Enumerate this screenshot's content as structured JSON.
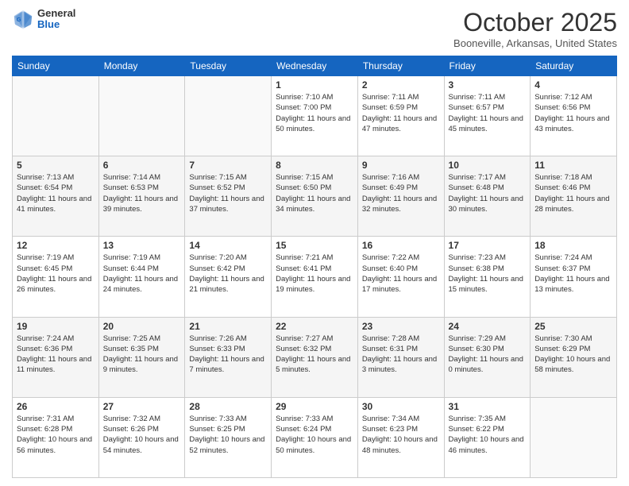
{
  "header": {
    "logo": {
      "general": "General",
      "blue": "Blue"
    },
    "title": "October 2025",
    "location": "Booneville, Arkansas, United States"
  },
  "weekdays": [
    "Sunday",
    "Monday",
    "Tuesday",
    "Wednesday",
    "Thursday",
    "Friday",
    "Saturday"
  ],
  "weeks": [
    [
      {
        "day": "",
        "sunrise": "",
        "sunset": "",
        "daylight": ""
      },
      {
        "day": "",
        "sunrise": "",
        "sunset": "",
        "daylight": ""
      },
      {
        "day": "",
        "sunrise": "",
        "sunset": "",
        "daylight": ""
      },
      {
        "day": "1",
        "sunrise": "Sunrise: 7:10 AM",
        "sunset": "Sunset: 7:00 PM",
        "daylight": "Daylight: 11 hours and 50 minutes."
      },
      {
        "day": "2",
        "sunrise": "Sunrise: 7:11 AM",
        "sunset": "Sunset: 6:59 PM",
        "daylight": "Daylight: 11 hours and 47 minutes."
      },
      {
        "day": "3",
        "sunrise": "Sunrise: 7:11 AM",
        "sunset": "Sunset: 6:57 PM",
        "daylight": "Daylight: 11 hours and 45 minutes."
      },
      {
        "day": "4",
        "sunrise": "Sunrise: 7:12 AM",
        "sunset": "Sunset: 6:56 PM",
        "daylight": "Daylight: 11 hours and 43 minutes."
      }
    ],
    [
      {
        "day": "5",
        "sunrise": "Sunrise: 7:13 AM",
        "sunset": "Sunset: 6:54 PM",
        "daylight": "Daylight: 11 hours and 41 minutes."
      },
      {
        "day": "6",
        "sunrise": "Sunrise: 7:14 AM",
        "sunset": "Sunset: 6:53 PM",
        "daylight": "Daylight: 11 hours and 39 minutes."
      },
      {
        "day": "7",
        "sunrise": "Sunrise: 7:15 AM",
        "sunset": "Sunset: 6:52 PM",
        "daylight": "Daylight: 11 hours and 37 minutes."
      },
      {
        "day": "8",
        "sunrise": "Sunrise: 7:15 AM",
        "sunset": "Sunset: 6:50 PM",
        "daylight": "Daylight: 11 hours and 34 minutes."
      },
      {
        "day": "9",
        "sunrise": "Sunrise: 7:16 AM",
        "sunset": "Sunset: 6:49 PM",
        "daylight": "Daylight: 11 hours and 32 minutes."
      },
      {
        "day": "10",
        "sunrise": "Sunrise: 7:17 AM",
        "sunset": "Sunset: 6:48 PM",
        "daylight": "Daylight: 11 hours and 30 minutes."
      },
      {
        "day": "11",
        "sunrise": "Sunrise: 7:18 AM",
        "sunset": "Sunset: 6:46 PM",
        "daylight": "Daylight: 11 hours and 28 minutes."
      }
    ],
    [
      {
        "day": "12",
        "sunrise": "Sunrise: 7:19 AM",
        "sunset": "Sunset: 6:45 PM",
        "daylight": "Daylight: 11 hours and 26 minutes."
      },
      {
        "day": "13",
        "sunrise": "Sunrise: 7:19 AM",
        "sunset": "Sunset: 6:44 PM",
        "daylight": "Daylight: 11 hours and 24 minutes."
      },
      {
        "day": "14",
        "sunrise": "Sunrise: 7:20 AM",
        "sunset": "Sunset: 6:42 PM",
        "daylight": "Daylight: 11 hours and 21 minutes."
      },
      {
        "day": "15",
        "sunrise": "Sunrise: 7:21 AM",
        "sunset": "Sunset: 6:41 PM",
        "daylight": "Daylight: 11 hours and 19 minutes."
      },
      {
        "day": "16",
        "sunrise": "Sunrise: 7:22 AM",
        "sunset": "Sunset: 6:40 PM",
        "daylight": "Daylight: 11 hours and 17 minutes."
      },
      {
        "day": "17",
        "sunrise": "Sunrise: 7:23 AM",
        "sunset": "Sunset: 6:38 PM",
        "daylight": "Daylight: 11 hours and 15 minutes."
      },
      {
        "day": "18",
        "sunrise": "Sunrise: 7:24 AM",
        "sunset": "Sunset: 6:37 PM",
        "daylight": "Daylight: 11 hours and 13 minutes."
      }
    ],
    [
      {
        "day": "19",
        "sunrise": "Sunrise: 7:24 AM",
        "sunset": "Sunset: 6:36 PM",
        "daylight": "Daylight: 11 hours and 11 minutes."
      },
      {
        "day": "20",
        "sunrise": "Sunrise: 7:25 AM",
        "sunset": "Sunset: 6:35 PM",
        "daylight": "Daylight: 11 hours and 9 minutes."
      },
      {
        "day": "21",
        "sunrise": "Sunrise: 7:26 AM",
        "sunset": "Sunset: 6:33 PM",
        "daylight": "Daylight: 11 hours and 7 minutes."
      },
      {
        "day": "22",
        "sunrise": "Sunrise: 7:27 AM",
        "sunset": "Sunset: 6:32 PM",
        "daylight": "Daylight: 11 hours and 5 minutes."
      },
      {
        "day": "23",
        "sunrise": "Sunrise: 7:28 AM",
        "sunset": "Sunset: 6:31 PM",
        "daylight": "Daylight: 11 hours and 3 minutes."
      },
      {
        "day": "24",
        "sunrise": "Sunrise: 7:29 AM",
        "sunset": "Sunset: 6:30 PM",
        "daylight": "Daylight: 11 hours and 0 minutes."
      },
      {
        "day": "25",
        "sunrise": "Sunrise: 7:30 AM",
        "sunset": "Sunset: 6:29 PM",
        "daylight": "Daylight: 10 hours and 58 minutes."
      }
    ],
    [
      {
        "day": "26",
        "sunrise": "Sunrise: 7:31 AM",
        "sunset": "Sunset: 6:28 PM",
        "daylight": "Daylight: 10 hours and 56 minutes."
      },
      {
        "day": "27",
        "sunrise": "Sunrise: 7:32 AM",
        "sunset": "Sunset: 6:26 PM",
        "daylight": "Daylight: 10 hours and 54 minutes."
      },
      {
        "day": "28",
        "sunrise": "Sunrise: 7:33 AM",
        "sunset": "Sunset: 6:25 PM",
        "daylight": "Daylight: 10 hours and 52 minutes."
      },
      {
        "day": "29",
        "sunrise": "Sunrise: 7:33 AM",
        "sunset": "Sunset: 6:24 PM",
        "daylight": "Daylight: 10 hours and 50 minutes."
      },
      {
        "day": "30",
        "sunrise": "Sunrise: 7:34 AM",
        "sunset": "Sunset: 6:23 PM",
        "daylight": "Daylight: 10 hours and 48 minutes."
      },
      {
        "day": "31",
        "sunrise": "Sunrise: 7:35 AM",
        "sunset": "Sunset: 6:22 PM",
        "daylight": "Daylight: 10 hours and 46 minutes."
      },
      {
        "day": "",
        "sunrise": "",
        "sunset": "",
        "daylight": ""
      }
    ]
  ]
}
